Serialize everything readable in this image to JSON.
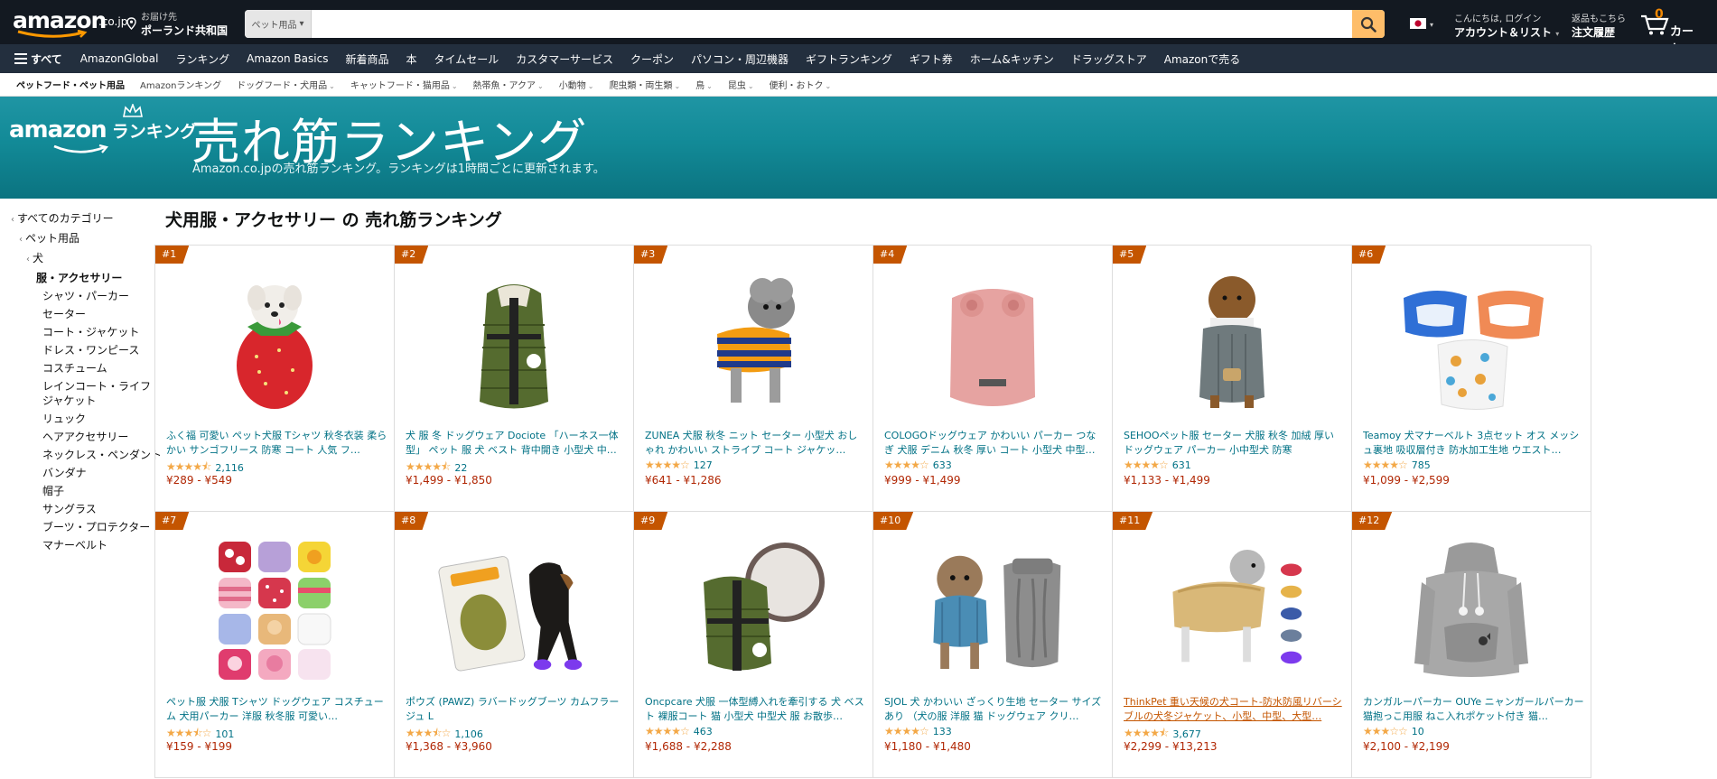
{
  "header": {
    "logo_text": "amazon",
    "logo_suffix": ".co.jp",
    "deliver_line1": "お届け先",
    "deliver_line2": "ポーランド共和国",
    "search_category": "ペット用品",
    "search_placeholder": "",
    "account_line1": "こんにちは, ログイン",
    "account_line2": "アカウント＆リスト",
    "orders_line1": "返品もこちら",
    "orders_line2": "注文履歴",
    "cart_count": "0",
    "cart_label": "カート"
  },
  "nav": {
    "all_label": "すべて",
    "items": [
      "AmazonGlobal",
      "ランキング",
      "Amazon Basics",
      "新着商品",
      "本",
      "タイムセール",
      "カスタマーサービス",
      "クーポン",
      "パソコン・周辺機器",
      "ギフトランキング",
      "ギフト券",
      "ホーム&キッチン",
      "ドラッグストア",
      "Amazonで売る"
    ]
  },
  "subnav": {
    "items": [
      "ペットフード・ペット用品",
      "Amazonランキング",
      "ドッグフード・犬用品",
      "キャットフード・猫用品",
      "熱帯魚・アクア",
      "小動物",
      "爬虫類・両生類",
      "鳥",
      "昆虫",
      "便利・おトク"
    ]
  },
  "banner": {
    "logo_word": "amazon",
    "logo_ranking": "ランキング",
    "title": "売れ筋ランキング",
    "subtitle": "Amazon.co.jpの売れ筋ランキング。ランキングは1時間ごとに更新されます。"
  },
  "sidebar": {
    "all_categories": "すべてのカテゴリー",
    "pet": "ペット用品",
    "dog": "犬",
    "current": "服・アクセサリー",
    "leaves": [
      "シャツ・パーカー",
      "セーター",
      "コート・ジャケット",
      "ドレス・ワンピース",
      "コスチューム",
      "レインコート・ライフ",
      "ジャケット",
      "リュック",
      "ヘアアクセサリー",
      "ネックレス・ペンダント",
      "バンダナ",
      "帽子",
      "サングラス",
      "ブーツ・プロテクター",
      "マナーベルト"
    ]
  },
  "page": {
    "heading": "犬用服・アクセサリー の 売れ筋ランキング"
  },
  "products": [
    {
      "rank": "#1",
      "title": "ふく福 可愛い ペット犬服 Tシャツ 秋冬衣装 柔らかい サンゴフリース 防寒 コート 人気 フ…",
      "stars": 4.5,
      "rating_count": "2,116",
      "price": "¥289 - ¥549",
      "icon": "strawberry-dog-costume"
    },
    {
      "rank": "#2",
      "title": "犬 服 冬 ドッグウェア Dociote 「ハーネス一体型」 ペット 服 犬 ベスト 背中開き 小型犬 中…",
      "stars": 4.5,
      "rating_count": "22",
      "price": "¥1,499 - ¥1,850",
      "icon": "green-padded-vest"
    },
    {
      "rank": "#3",
      "title": "ZUNEA 犬服 秋冬 ニット セーター 小型犬 おしゃれ かわいい ストライプ コート ジャケッ…",
      "stars": 4.0,
      "rating_count": "127",
      "price": "¥641 - ¥1,286",
      "icon": "striped-dog-sweater"
    },
    {
      "rank": "#4",
      "title": "COLOGOドッグウェア かわいい パーカー つなぎ 犬服 デニム 秋冬 厚い コート 小型犬 中型…",
      "stars": 4.0,
      "rating_count": "633",
      "price": "¥999 - ¥1,499",
      "icon": "pink-fleece-coat"
    },
    {
      "rank": "#5",
      "title": "SEHOOペット服 セーター 犬服 秋冬 加絨 厚い ドッグウェア パーカー 小中型犬 防寒",
      "stars": 4.0,
      "rating_count": "631",
      "price": "¥1,133 - ¥1,499",
      "icon": "gray-knit-hoodie"
    },
    {
      "rank": "#6",
      "title": "Teamoy 犬マナーベルト 3点セット オス メッシュ裏地 吸収層付き 防水加工生地 ウエスト…",
      "stars": 4.0,
      "rating_count": "785",
      "price": "¥1,099 - ¥2,599",
      "icon": "manner-belt-set"
    },
    {
      "rank": "#7",
      "title": "ペット服 犬服 Tシャツ ドッグウェア コスチューム 犬用パーカー 洋服 秋冬服 可愛い…",
      "stars": 3.5,
      "rating_count": "101",
      "price": "¥159 - ¥199",
      "icon": "assorted-dog-shirts"
    },
    {
      "rank": "#8",
      "title": "ポウズ (PAWZ) ラバードッグブーツ カムフラージュ L",
      "stars": 3.5,
      "rating_count": "1,106",
      "price": "¥1,368 - ¥3,960",
      "icon": "rubber-dog-boots"
    },
    {
      "rank": "#9",
      "title": "Oncpcare 犬服 一体型縛入れを牽引する 犬 ベスト 裸服コート 猫 小型犬 中型犬 服 お散歩…",
      "stars": 4.0,
      "rating_count": "463",
      "price": "¥1,688 - ¥2,288",
      "icon": "green-harness-vest"
    },
    {
      "rank": "#10",
      "title": "SJOL 犬 かわいい ざっくり生地 セーター サイズあり （犬の服 洋服 猫 ドッグウェア クリ…",
      "stars": 4.0,
      "rating_count": "133",
      "price": "¥1,180 - ¥1,480",
      "icon": "knit-sweater-dog"
    },
    {
      "rank": "#11",
      "title": "ThinkPet 重い天候の犬コート-防水防風リバーシブルの犬冬ジャケット、小型、中型、大型…",
      "stars": 4.5,
      "rating_count": "3,677",
      "price": "¥2,299 - ¥13,213",
      "icon": "reversible-dog-jacket",
      "hover": true
    },
    {
      "rank": "#12",
      "title": "カンガルーパーカー OUYe ニャンガールパーカー 猫抱っこ用服 ねこ入れポケット付き 猫…",
      "stars": 3.0,
      "rating_count": "10",
      "price": "¥2,100 - ¥2,199",
      "icon": "gray-pouch-hoodie"
    }
  ],
  "colors": {
    "nav_dark": "#131921",
    "nav_main": "#232f3e",
    "banner": "#128a97",
    "rank_badge": "#c45500",
    "link": "#007185",
    "price": "#b12704",
    "star": "#f3a847",
    "search_button": "#febd69"
  }
}
